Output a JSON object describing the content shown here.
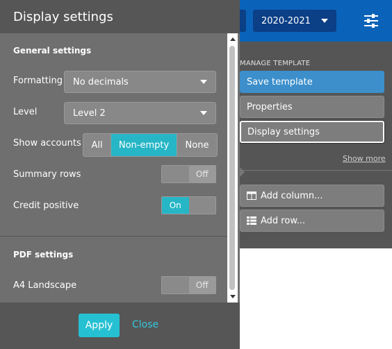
{
  "background": {
    "year_select": "2020-2021",
    "manage_template": {
      "heading": "MANAGE TEMPLATE",
      "save": "Save template",
      "properties": "Properties",
      "display_settings": "Display settings",
      "show_more": "Show more",
      "add_column": "Add column...",
      "add_row": "Add row..."
    }
  },
  "modal": {
    "title": "Display settings",
    "general": {
      "title": "General settings",
      "formatting": {
        "label": "Formatting",
        "value": "No decimals"
      },
      "level": {
        "label": "Level",
        "value": "Level 2"
      },
      "show_accounts": {
        "label": "Show accounts",
        "options": [
          "All",
          "Non-empty",
          "None"
        ],
        "selected": "Non-empty"
      },
      "summary_rows": {
        "label": "Summary rows",
        "state": "Off"
      },
      "credit_positive": {
        "label": "Credit positive",
        "state": "On"
      }
    },
    "pdf": {
      "title": "PDF settings",
      "a4_landscape": {
        "label": "A4 Landscape",
        "state": "Off"
      }
    },
    "footer": {
      "apply": "Apply",
      "close": "Close"
    }
  },
  "colors": {
    "accent": "#26b6c6",
    "topbar": "#0a63b8",
    "save_button": "#3c8fcb"
  }
}
